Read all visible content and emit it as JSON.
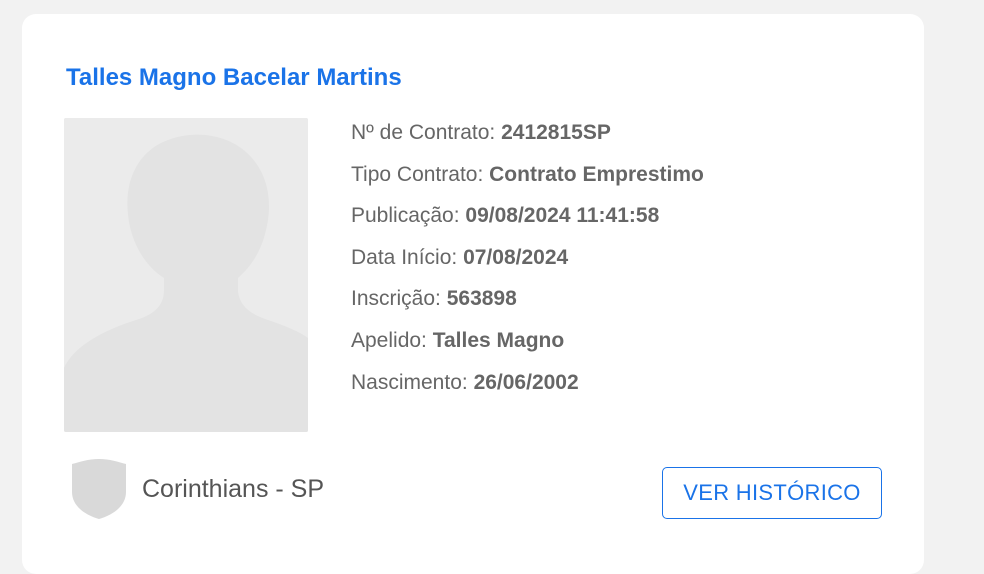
{
  "athlete": {
    "name": "Talles Magno Bacelar Martins"
  },
  "details": [
    {
      "label": "Nº de Contrato:",
      "value": "2412815SP"
    },
    {
      "label": "Tipo Contrato:",
      "value": "Contrato Emprestimo"
    },
    {
      "label": "Publicação:",
      "value": "09/08/2024 11:41:58"
    },
    {
      "label": "Data Início:",
      "value": "07/08/2024"
    },
    {
      "label": "Inscrição:",
      "value": "563898"
    },
    {
      "label": "Apelido:",
      "value": "Talles Magno"
    },
    {
      "label": "Nascimento:",
      "value": "26/06/2002"
    }
  ],
  "club": {
    "name": "Corinthians - SP",
    "crest_icon": "shield-icon"
  },
  "actions": {
    "history_label": "VER HISTÓRICO"
  },
  "colors": {
    "accent": "#1a73e8",
    "text": "#666666",
    "placeholder": "#ebebeb",
    "background": "#f2f2f2"
  }
}
